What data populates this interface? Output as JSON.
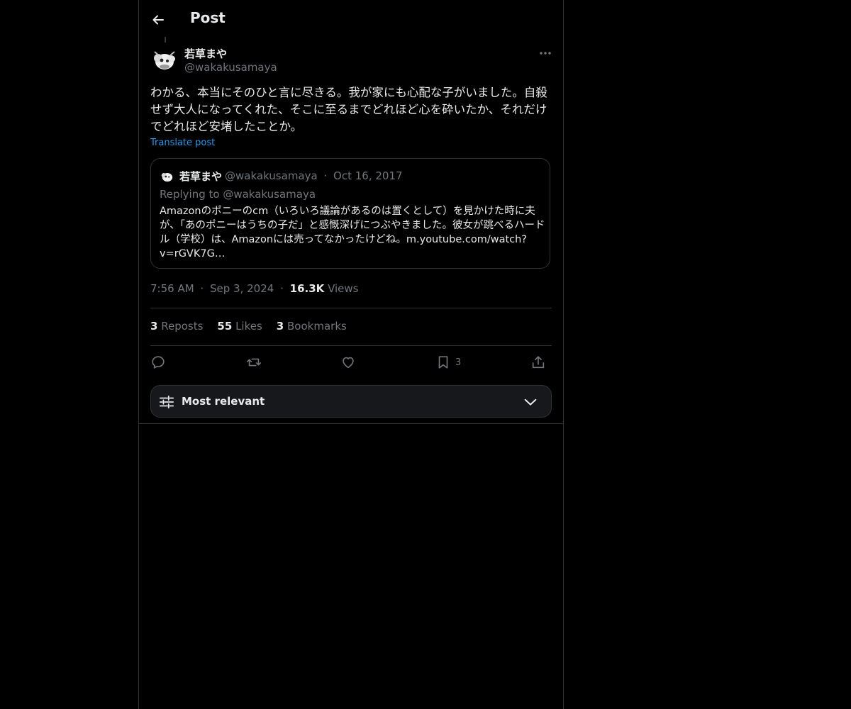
{
  "header": {
    "title": "Post",
    "back_icon": "arrow-left-icon"
  },
  "post": {
    "display_name": "若草まや",
    "handle": "@wakakusamaya",
    "text": "わかる、本当にそのひと言に尽きる。我が家にも心配な子がいました。自殺せず大人になってくれた、そこに至るまでどれほど心を砕いたか、それだけでどれほど安堵したことか。",
    "translate_label": "Translate post",
    "time": "7:56 AM",
    "separator": "·",
    "date": "Sep 3, 2024",
    "views_count": "16.3K",
    "views_label": "Views"
  },
  "quote": {
    "display_name": "若草まや",
    "handle": "@wakakusamaya",
    "separator": "·",
    "date": "Oct 16, 2017",
    "replying_to": "Replying to @wakakusamaya",
    "text": "Amazonのポニーのcm（いろいろ議論があるのは置くとして）を見かけた時に夫が、「あのポニーはうちの子だ」と感慨深げにつぶやきました。彼女が跳べるハードル（学校）は、Amazonには売ってなかったけどね。m.youtube.com/watch?v=rGVK7G…"
  },
  "stats": {
    "reposts_count": "3",
    "reposts_label": "Reposts",
    "likes_count": "55",
    "likes_label": "Likes",
    "bookmarks_count": "3",
    "bookmarks_label": "Bookmarks"
  },
  "actions": {
    "reply_icon": "reply-icon",
    "repost_icon": "repost-icon",
    "like_icon": "heart-icon",
    "bookmark_icon": "bookmark-icon",
    "bookmark_count": "3",
    "share_icon": "share-icon"
  },
  "sort": {
    "label": "Most relevant",
    "icon": "sliders-icon",
    "chevron": "chevron-down-icon"
  },
  "colors": {
    "background": "#000000",
    "text": "#e7e9ea",
    "muted": "#71767b",
    "link": "#1d9bf0",
    "border": "#2f3336"
  }
}
